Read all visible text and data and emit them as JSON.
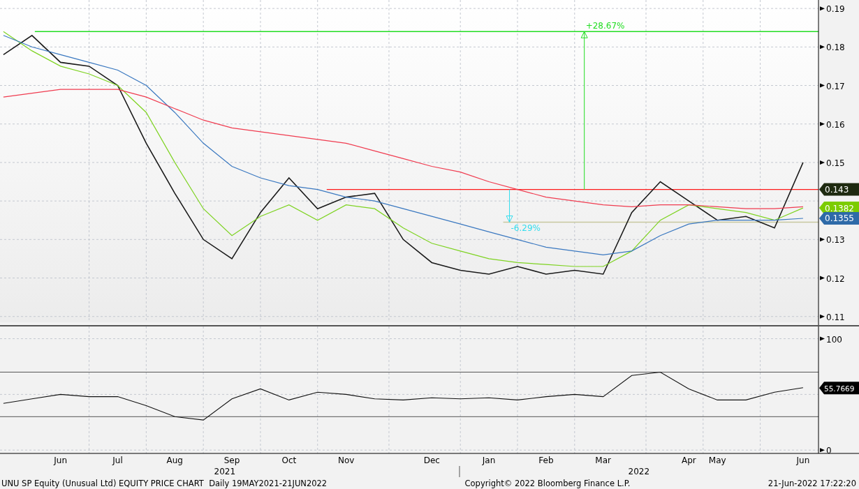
{
  "price_chart": {
    "chart_data": {
      "type": "line",
      "categories": [
        null,
        null,
        null,
        null,
        null,
        null,
        null,
        null,
        null,
        null,
        null,
        null,
        null,
        null,
        null,
        null,
        null,
        null,
        null,
        null,
        null,
        null,
        null,
        null,
        null,
        null,
        null,
        null,
        null
      ],
      "ylim": [
        0.1085,
        0.1922
      ],
      "yticks": [
        0.11,
        0.12,
        0.13,
        0.15,
        0.16,
        0.17,
        0.18,
        0.19
      ],
      "series": [
        {
          "color": "#1a1a1a",
          "values": [
            0.178,
            0.183,
            0.176,
            0.175,
            0.17,
            0.155,
            0.142,
            0.13,
            0.125,
            0.137,
            0.146,
            0.138,
            0.141,
            0.142,
            0.13,
            0.124,
            0.122,
            0.121,
            0.123,
            0.121,
            0.122,
            0.121,
            0.137,
            0.145,
            0.14,
            0.135,
            0.136,
            0.133,
            0.15
          ]
        },
        {
          "color": "#7ed321",
          "values": [
            0.184,
            0.179,
            0.175,
            0.173,
            0.17,
            0.163,
            0.15,
            0.138,
            0.131,
            0.136,
            0.139,
            0.135,
            0.139,
            0.138,
            0.133,
            0.129,
            0.127,
            0.125,
            0.124,
            0.1235,
            0.123,
            0.123,
            0.127,
            0.135,
            0.139,
            0.138,
            0.137,
            0.135,
            0.1382
          ]
        },
        {
          "color": "#3a78c0",
          "values": [
            0.183,
            0.18,
            0.178,
            0.176,
            0.174,
            0.17,
            0.163,
            0.155,
            0.149,
            0.146,
            0.144,
            0.143,
            0.141,
            0.14,
            0.138,
            0.136,
            0.134,
            0.132,
            0.13,
            0.128,
            0.127,
            0.126,
            0.127,
            0.131,
            0.134,
            0.135,
            0.135,
            0.135,
            0.1355
          ]
        },
        {
          "color": "#f03c50",
          "values": [
            0.167,
            0.168,
            0.169,
            0.169,
            0.169,
            0.167,
            0.164,
            0.161,
            0.159,
            0.158,
            0.157,
            0.156,
            0.155,
            0.153,
            0.151,
            0.149,
            0.1475,
            0.145,
            0.143,
            0.141,
            0.14,
            0.139,
            0.1385,
            0.139,
            0.139,
            0.1385,
            0.138,
            0.138,
            0.1385
          ]
        }
      ],
      "grid": true,
      "ref_lines": [
        {
          "axis": "y",
          "value": 0.184,
          "color": "#22dd22"
        },
        {
          "axis": "y",
          "value": 0.143,
          "color": "#ff1a1a"
        },
        {
          "axis": "y",
          "value": 0.1345,
          "color": "#c8c8a0"
        }
      ],
      "annotations": [
        "+28.67%",
        "-6.29%"
      ]
    },
    "value_tags": [
      {
        "text": "0.143",
        "color": "#1e2a10"
      },
      {
        "text": "0.1382",
        "color": "#7ccc00"
      },
      {
        "text": "0.1355",
        "color": "#2e6aa8"
      }
    ]
  },
  "rsi_chart": {
    "chart_data": {
      "type": "line",
      "categories": [
        null,
        null,
        "Jun",
        null,
        "Jul",
        null,
        "Aug",
        null,
        "Sep",
        null,
        "Oct",
        null,
        "Nov",
        null,
        null,
        "Dec",
        null,
        "Jan",
        null,
        "Feb",
        null,
        "Mar",
        null,
        null,
        "Apr",
        "May",
        null,
        null,
        "Jun"
      ],
      "ylim": [
        -3,
        111
      ],
      "yticks": [
        0,
        100
      ],
      "series": [
        {
          "color": "#111111",
          "values": [
            42,
            46,
            50,
            48,
            48,
            40,
            30,
            27,
            46,
            55,
            45,
            52,
            50,
            46,
            45,
            47,
            46,
            47,
            45,
            48,
            50,
            48,
            67,
            70,
            55,
            45,
            45,
            52,
            56
          ]
        }
      ],
      "grid": true,
      "ref_lines": [
        {
          "axis": "y",
          "value": 70,
          "color": "#555555"
        },
        {
          "axis": "y",
          "value": 30,
          "color": "#555555"
        }
      ]
    },
    "value_tags": [
      {
        "text": "55.7669",
        "color": "#000000"
      }
    ]
  },
  "years": [
    "2021",
    "2022"
  ],
  "footer": {
    "title": "UNU SP Equity (Unusual Ltd) EQUITY PRICE CHART  Daily 19MAY2021-21JUN2022",
    "copyright": "Copyright© 2022 Bloomberg Finance L.P.",
    "timestamp": "21-Jun-2022 17:22:20"
  }
}
